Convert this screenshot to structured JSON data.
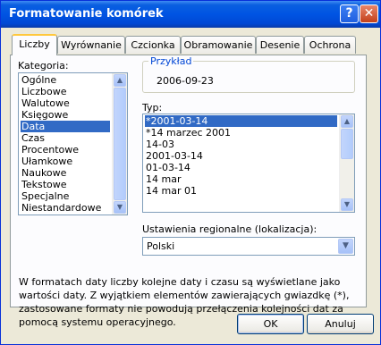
{
  "window": {
    "title": "Formatowanie komórek",
    "help": "?",
    "close": "✕"
  },
  "tabs": [
    "Liczby",
    "Wyrównanie",
    "Czcionka",
    "Obramowanie",
    "Desenie",
    "Ochrona"
  ],
  "category": {
    "label": "Kategoria:",
    "items": [
      "Ogólne",
      "Liczbowe",
      "Walutowe",
      "Księgowe",
      "Data",
      "Czas",
      "Procentowe",
      "Ułamkowe",
      "Naukowe",
      "Tekstowe",
      "Specjalne",
      "Niestandardowe"
    ],
    "selected": "Data"
  },
  "sample": {
    "label": "Przykład",
    "value": "2006-09-23"
  },
  "type": {
    "label": "Typ:",
    "items": [
      "*2001-03-14",
      "*14 marzec 2001",
      "14-03",
      "2001-03-14",
      "01-03-14",
      "14 mar",
      "14 mar 01"
    ],
    "selected": "*2001-03-14"
  },
  "locale": {
    "label": "Ustawienia regionalne (lokalizacja):",
    "value": "Polski"
  },
  "description": "W formatach daty liczby kolejne daty i czasu są wyświetlane jako wartości daty. Z wyjątkiem elementów zawierających gwiazdkę (*), zastosowane formaty nie powodują przełączenia kolejności dat za pomocą systemu operacyjnego.",
  "buttons": {
    "ok": "OK",
    "cancel": "Anuluj"
  }
}
